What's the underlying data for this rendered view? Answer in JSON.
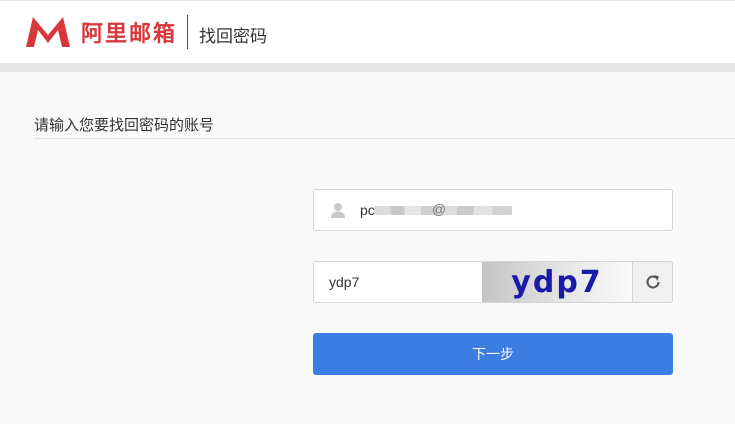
{
  "header": {
    "brand_name": "阿里邮箱",
    "page_title": "找回密码"
  },
  "form": {
    "section_title": "请输入您要找回密码的账号",
    "account_prefix": "pc",
    "account_at": "@",
    "captcha_value": "ydp7",
    "captcha_image_text": "ydp7",
    "next_label": "下一步"
  },
  "colors": {
    "brand_red": "#d8383b",
    "primary_blue": "#3b7de3",
    "captcha_text": "#1a1aa8"
  },
  "icons": [
    "logo-m-icon",
    "user-icon",
    "refresh-icon"
  ]
}
